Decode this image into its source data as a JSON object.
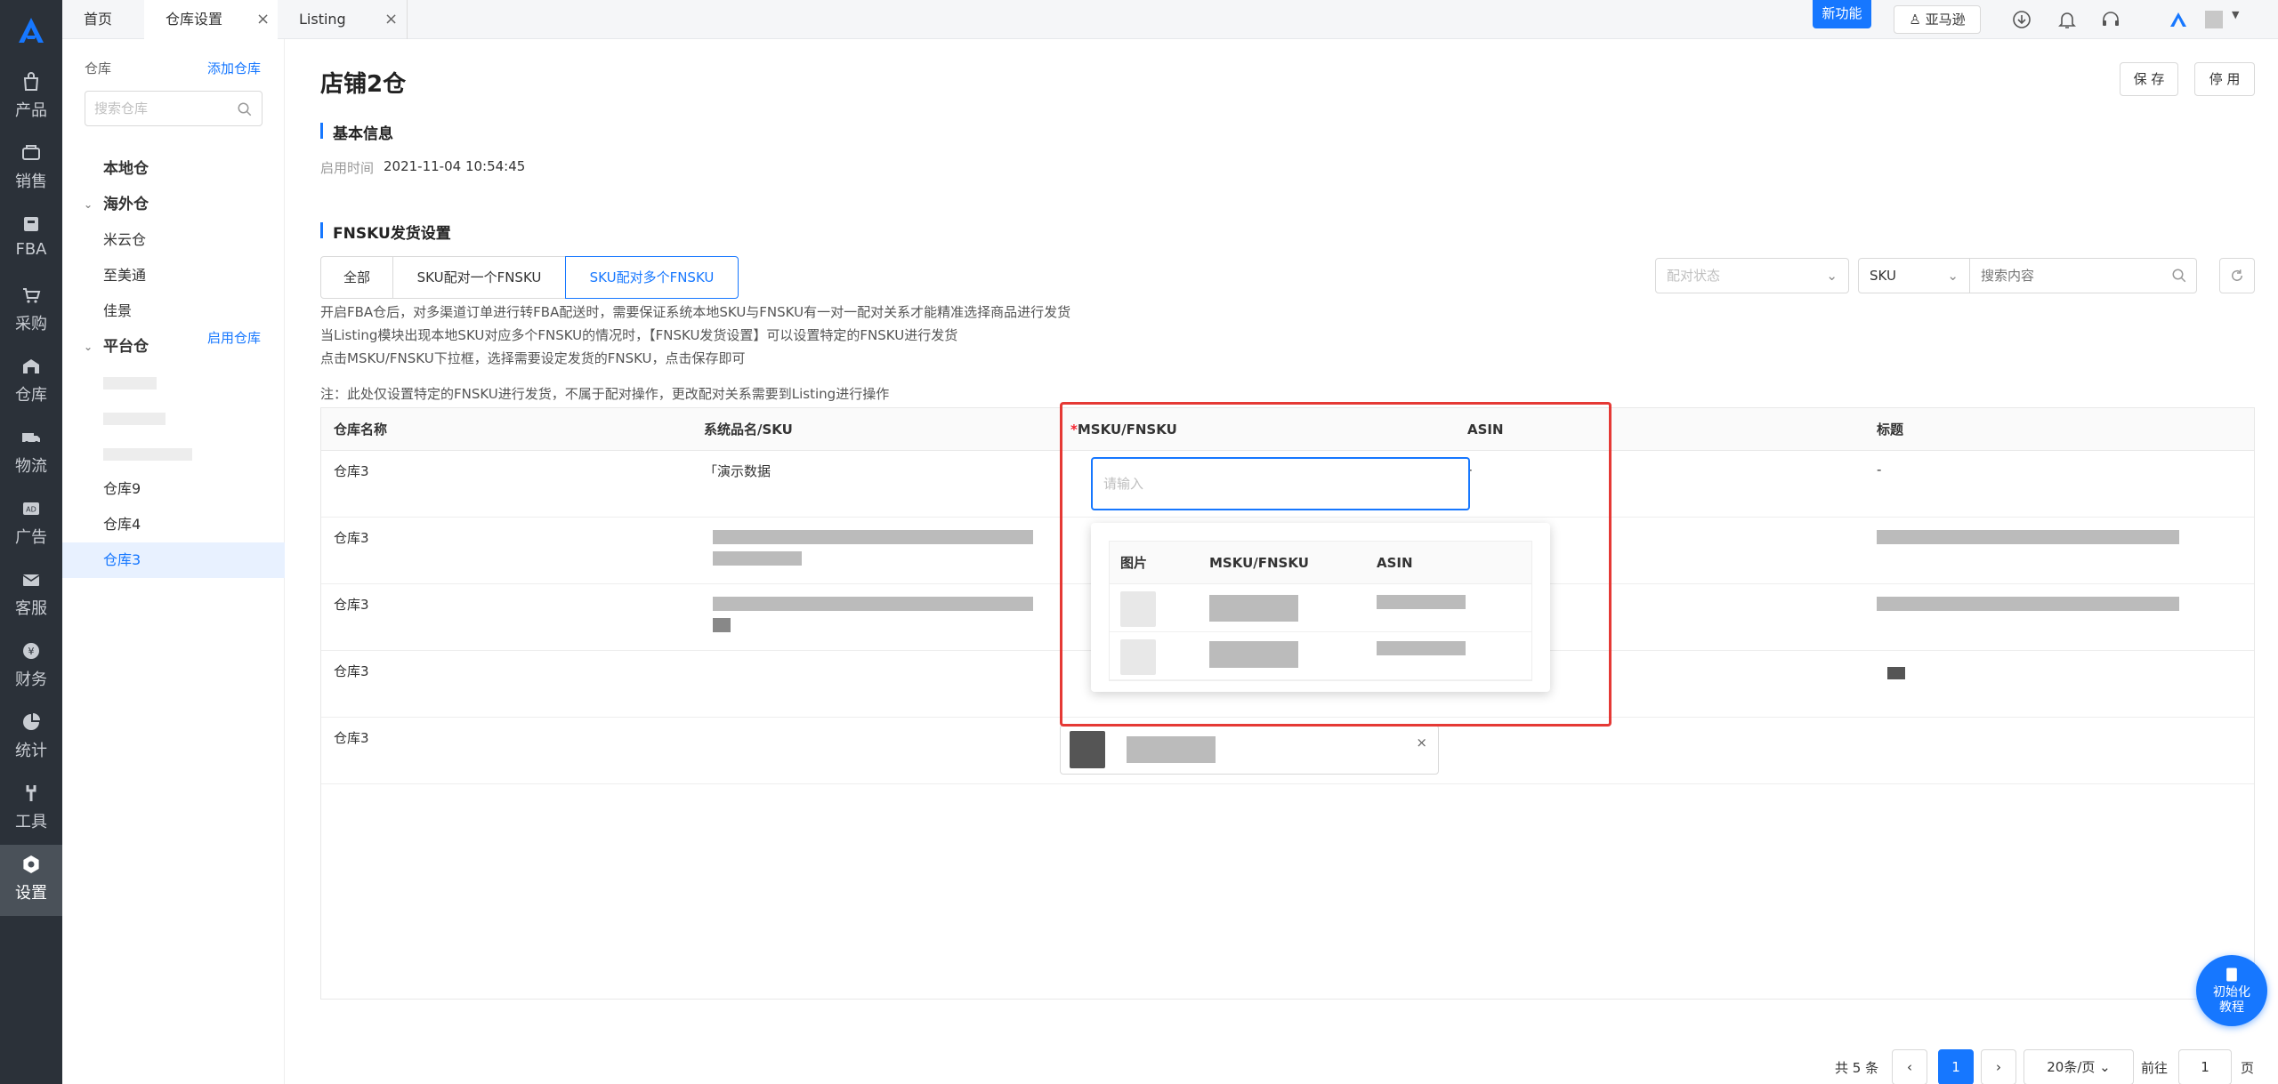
{
  "nav": {
    "items": [
      {
        "label": "产品",
        "icon": "bag-icon"
      },
      {
        "label": "销售",
        "icon": "sale-icon"
      },
      {
        "label": "FBA",
        "icon": "fba-icon"
      },
      {
        "label": "采购",
        "icon": "cart-icon"
      },
      {
        "label": "仓库",
        "icon": "warehouse-icon"
      },
      {
        "label": "物流",
        "icon": "truck-icon"
      },
      {
        "label": "广告",
        "icon": "ad-icon"
      },
      {
        "label": "客服",
        "icon": "mail-icon"
      },
      {
        "label": "财务",
        "icon": "finance-icon"
      },
      {
        "label": "统计",
        "icon": "pie-icon"
      },
      {
        "label": "工具",
        "icon": "wrench-icon"
      },
      {
        "label": "设置",
        "icon": "gear-icon"
      }
    ]
  },
  "tabs": [
    {
      "label": "首页"
    },
    {
      "label": "仓库设置"
    },
    {
      "label": "Listing"
    }
  ],
  "topbar": {
    "new_feature": "新功能",
    "store": "亚马逊"
  },
  "warehouse_panel": {
    "title": "仓库",
    "add_label": "添加仓库",
    "search_placeholder": "搜索仓库",
    "local": "本地仓",
    "overseas": "海外仓",
    "overseas_items": [
      "米云仓",
      "至美通",
      "佳景"
    ],
    "platform": "平台仓",
    "enable_label": "启用仓库",
    "platform_items": [
      "仓库9",
      "仓库4",
      "仓库3"
    ]
  },
  "page": {
    "title": "店铺2仓",
    "save": "保 存",
    "disable": "停 用",
    "basic_info": "基本信息",
    "start_time_label": "启用时间",
    "start_time": "2021-11-04 10:54:45",
    "fnsku_section": "FNSKU发货设置"
  },
  "segments": [
    "全部",
    "SKU配对一个FNSKU",
    "SKU配对多个FNSKU"
  ],
  "filters": {
    "status_placeholder": "配对状态",
    "field": "SKU",
    "search_placeholder": "搜索内容"
  },
  "description": [
    "开启FBA仓后，对多渠道订单进行转FBA配送时，需要保证系统本地SKU与FNSKU有一对一配对关系才能精准选择商品进行发货",
    "当Listing模块出现本地SKU对应多个FNSKU的情况时，【FNSKU发货设置】可以设置特定的FNSKU进行发货",
    "点击MSKU/FNSKU下拉框，选择需要设定发货的FNSKU，点击保存即可"
  ],
  "note": "注：此处仅设置特定的FNSKU进行发货，不属于配对操作，更改配对关系需要到Listing进行操作",
  "table": {
    "headers": {
      "warehouse": "仓库名称",
      "sku": "系统品名/SKU",
      "req": "*",
      "msku": "MSKU/FNSKU",
      "asin": "ASIN",
      "title": "标题"
    },
    "rows": [
      {
        "warehouse": "仓库3",
        "sku": "「演示数据",
        "asin": "-",
        "title": "-"
      },
      {
        "warehouse": "仓库3",
        "sku": "",
        "asin": "",
        "title": ""
      },
      {
        "warehouse": "仓库3",
        "sku": "",
        "asin": "",
        "title": ""
      },
      {
        "warehouse": "仓库3",
        "sku": "",
        "asin": "",
        "title": ""
      },
      {
        "warehouse": "仓库3",
        "sku": "",
        "asin": "",
        "title": ""
      }
    ],
    "msku_placeholder": "请输入"
  },
  "dropdown": {
    "headers": {
      "img": "图片",
      "msku": "MSKU/FNSKU",
      "asin": "ASIN"
    }
  },
  "pagination": {
    "total": "共 5 条",
    "current": "1",
    "page_size": "20条/页",
    "goto": "前往",
    "goto_value": "1",
    "page_unit": "页"
  },
  "tutorial": "初始化\n教程",
  "colors": {
    "accent": "#1677ff",
    "nav_bg": "#2b3139",
    "highlight": "#e53935"
  }
}
